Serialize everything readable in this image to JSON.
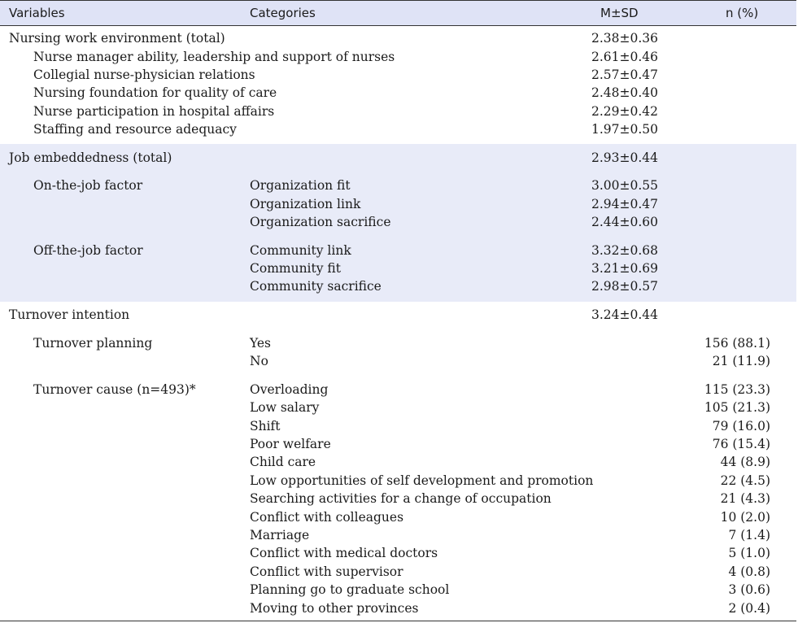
{
  "header": {
    "variables": "Variables",
    "categories": "Categories",
    "msd": "M±SD",
    "n": "n (%)"
  },
  "work_env": {
    "total": {
      "label": "Nursing work environment (total)",
      "msd": "2.38±0.36"
    },
    "items": [
      {
        "label": "Nurse manager ability, leadership and support of nurses",
        "msd": "2.61±0.46"
      },
      {
        "label": "Collegial nurse-physician relations",
        "msd": "2.57±0.47"
      },
      {
        "label": "Nursing foundation for quality of care",
        "msd": "2.48±0.40"
      },
      {
        "label": "Nurse participation in hospital affairs",
        "msd": "2.29±0.42"
      },
      {
        "label": "Staffing and resource adequacy",
        "msd": "1.97±0.50"
      }
    ]
  },
  "job_emb": {
    "total": {
      "label": "Job embeddedness (total)",
      "msd": "2.93±0.44"
    },
    "on_job": {
      "label": "On-the-job factor",
      "items": [
        {
          "category": "Organization fit",
          "msd": "3.00±0.55"
        },
        {
          "category": "Organization link",
          "msd": "2.94±0.47"
        },
        {
          "category": "Organization sacrifice",
          "msd": "2.44±0.60"
        }
      ]
    },
    "off_job": {
      "label": "Off-the-job factor",
      "items": [
        {
          "category": "Community link",
          "msd": "3.32±0.68"
        },
        {
          "category": "Community fit",
          "msd": "3.21±0.69"
        },
        {
          "category": "Community sacrifice",
          "msd": "2.98±0.57"
        }
      ]
    }
  },
  "turnover": {
    "total": {
      "label": "Turnover intention",
      "msd": "3.24±0.44"
    },
    "planning": {
      "label": "Turnover planning",
      "items": [
        {
          "category": "Yes",
          "n": "156 (88.1)"
        },
        {
          "category": "No",
          "n": "21 (11.9)"
        }
      ]
    },
    "cause": {
      "label": "Turnover cause (n=493)*",
      "items": [
        {
          "category": "Overloading",
          "n": "115 (23.3)"
        },
        {
          "category": "Low salary",
          "n": "105 (21.3)"
        },
        {
          "category": "Shift",
          "n": "79 (16.0)"
        },
        {
          "category": "Poor welfare",
          "n": "76 (15.4)"
        },
        {
          "category": "Child care",
          "n": "44 (8.9)"
        },
        {
          "category": "Low opportunities of self development and promotion",
          "n": "22 (4.5)"
        },
        {
          "category": "Searching activities for a change of occupation",
          "n": "21 (4.3)"
        },
        {
          "category": "Conflict with colleagues",
          "n": "10 (2.0)"
        },
        {
          "category": "Marriage",
          "n": "7 (1.4)"
        },
        {
          "category": "Conflict with medical doctors",
          "n": "5 (1.0)"
        },
        {
          "category": "Conflict with supervisor",
          "n": "4 (0.8)"
        },
        {
          "category": "Planning go to graduate school",
          "n": "3 (0.6)"
        },
        {
          "category": "Moving to other provinces",
          "n": "2 (0.4)"
        }
      ]
    }
  }
}
